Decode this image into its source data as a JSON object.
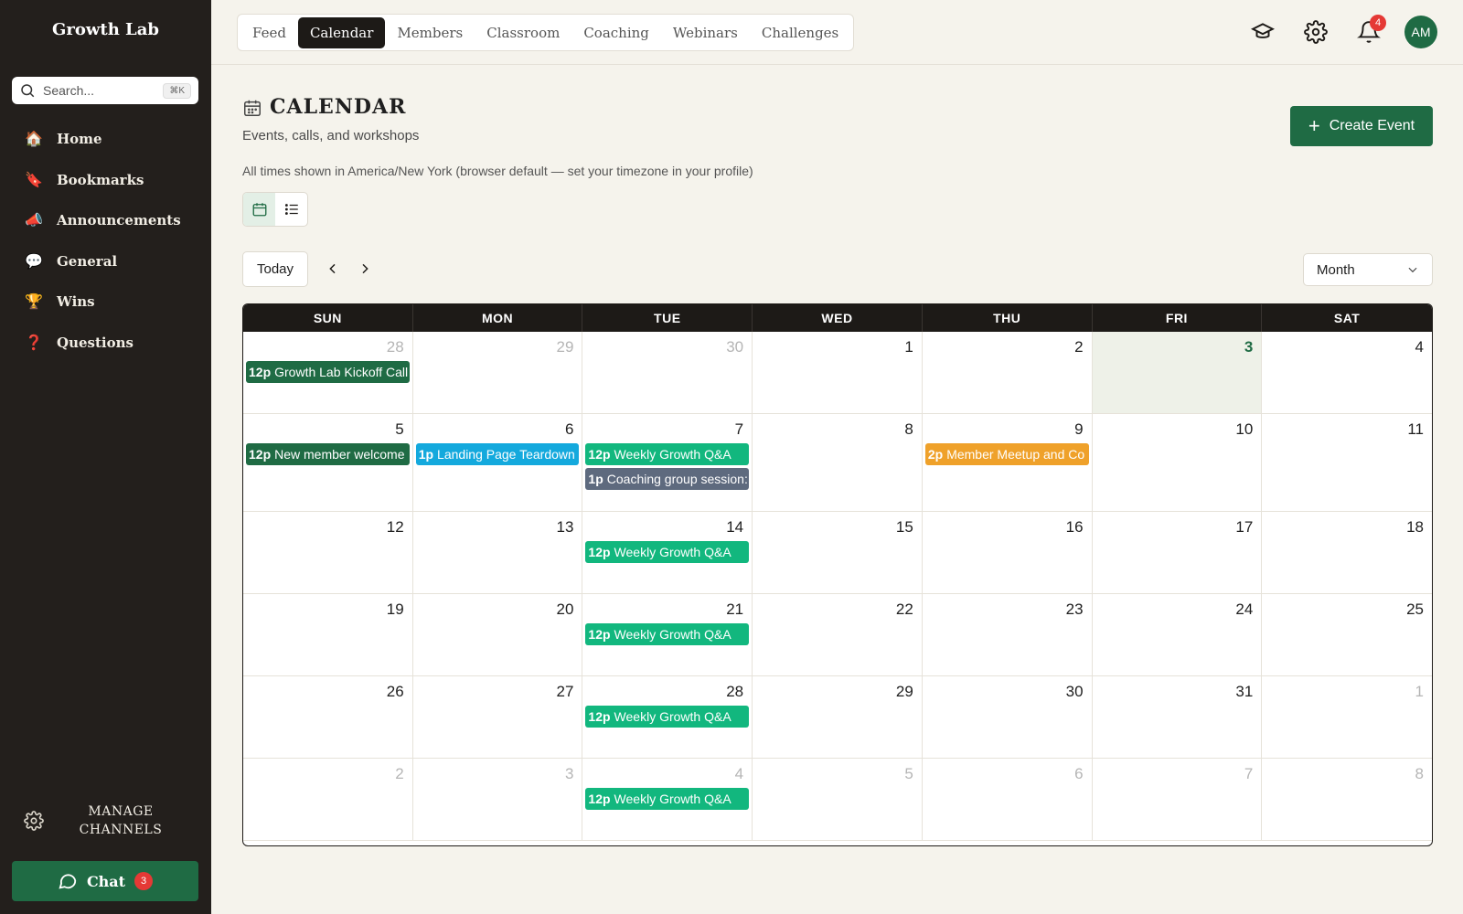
{
  "app": {
    "name": "Growth Lab"
  },
  "search": {
    "placeholder": "Search...",
    "shortcut": "⌘K"
  },
  "sidebar": {
    "items": [
      {
        "emoji": "🏠",
        "label": "Home",
        "icon": "house-icon"
      },
      {
        "emoji": "🔖",
        "label": "Bookmarks",
        "icon": "bookmark-icon"
      },
      {
        "emoji": "📣",
        "label": "Announcements",
        "icon": "megaphone-icon"
      },
      {
        "emoji": "💬",
        "label": "General",
        "icon": "speech-bubble-icon"
      },
      {
        "emoji": "🏆",
        "label": "Wins",
        "icon": "trophy-icon"
      },
      {
        "emoji": "❓",
        "label": "Questions",
        "icon": "question-icon"
      }
    ],
    "manage_line1": "MANAGE",
    "manage_line2": "CHANNELS",
    "chat_label": "Chat",
    "chat_badge": "3"
  },
  "topbar": {
    "tabs": [
      "Feed",
      "Calendar",
      "Members",
      "Classroom",
      "Coaching",
      "Webinars",
      "Challenges"
    ],
    "active_tab": "Calendar",
    "bell_badge": "4",
    "avatar_initials": "AM"
  },
  "page": {
    "title": "CALENDAR",
    "subtitle": "Events, calls, and workshops",
    "tz_note": "All times shown in America/New York (browser default — set your timezone in your profile)",
    "create_label": "Create Event",
    "today_label": "Today",
    "view_select": "Month"
  },
  "colors": {
    "brand_green": "#1f6b44",
    "teal": "#12b77e",
    "blue": "#14a9dd",
    "orange": "#efa12a",
    "slate": "#5e6a7e",
    "dark": "#1d1a17"
  },
  "calendar": {
    "weekdays": [
      "SUN",
      "MON",
      "TUE",
      "WED",
      "THU",
      "FRI",
      "SAT"
    ],
    "weeks": [
      [
        {
          "d": "28",
          "other": true,
          "events": [
            {
              "time": "12p",
              "title": "Growth Lab Kickoff Call",
              "color": "green"
            }
          ]
        },
        {
          "d": "29",
          "other": true,
          "events": []
        },
        {
          "d": "30",
          "other": true,
          "events": []
        },
        {
          "d": "1",
          "events": []
        },
        {
          "d": "2",
          "events": []
        },
        {
          "d": "3",
          "today": true,
          "events": []
        },
        {
          "d": "4",
          "events": []
        }
      ],
      [
        {
          "d": "5",
          "events": [
            {
              "time": "12p",
              "title": "New member welcome",
              "color": "green"
            }
          ]
        },
        {
          "d": "6",
          "events": [
            {
              "time": "1p",
              "title": "Landing Page Teardown",
              "color": "blue"
            }
          ]
        },
        {
          "d": "7",
          "events": [
            {
              "time": "12p",
              "title": "Weekly Growth Q&A",
              "color": "teal"
            },
            {
              "time": "1p",
              "title": "Coaching group session:",
              "color": "slate"
            }
          ]
        },
        {
          "d": "8",
          "events": []
        },
        {
          "d": "9",
          "events": [
            {
              "time": "2p",
              "title": "Member Meetup and Co",
              "color": "orange"
            }
          ]
        },
        {
          "d": "10",
          "events": []
        },
        {
          "d": "11",
          "events": []
        }
      ],
      [
        {
          "d": "12",
          "events": []
        },
        {
          "d": "13",
          "events": []
        },
        {
          "d": "14",
          "events": [
            {
              "time": "12p",
              "title": "Weekly Growth Q&A",
              "color": "teal"
            }
          ]
        },
        {
          "d": "15",
          "events": []
        },
        {
          "d": "16",
          "events": []
        },
        {
          "d": "17",
          "events": []
        },
        {
          "d": "18",
          "events": []
        }
      ],
      [
        {
          "d": "19",
          "events": []
        },
        {
          "d": "20",
          "events": []
        },
        {
          "d": "21",
          "events": [
            {
              "time": "12p",
              "title": "Weekly Growth Q&A",
              "color": "teal"
            }
          ]
        },
        {
          "d": "22",
          "events": []
        },
        {
          "d": "23",
          "events": []
        },
        {
          "d": "24",
          "events": []
        },
        {
          "d": "25",
          "events": []
        }
      ],
      [
        {
          "d": "26",
          "events": []
        },
        {
          "d": "27",
          "events": []
        },
        {
          "d": "28",
          "events": [
            {
              "time": "12p",
              "title": "Weekly Growth Q&A",
              "color": "teal"
            }
          ]
        },
        {
          "d": "29",
          "events": []
        },
        {
          "d": "30",
          "events": []
        },
        {
          "d": "31",
          "events": []
        },
        {
          "d": "1",
          "other": true,
          "events": []
        }
      ],
      [
        {
          "d": "2",
          "other": true,
          "events": []
        },
        {
          "d": "3",
          "other": true,
          "events": []
        },
        {
          "d": "4",
          "other": true,
          "events": [
            {
              "time": "12p",
              "title": "Weekly Growth Q&A",
              "color": "teal"
            }
          ]
        },
        {
          "d": "5",
          "other": true,
          "events": []
        },
        {
          "d": "6",
          "other": true,
          "events": []
        },
        {
          "d": "7",
          "other": true,
          "events": []
        },
        {
          "d": "8",
          "other": true,
          "events": []
        }
      ]
    ]
  }
}
